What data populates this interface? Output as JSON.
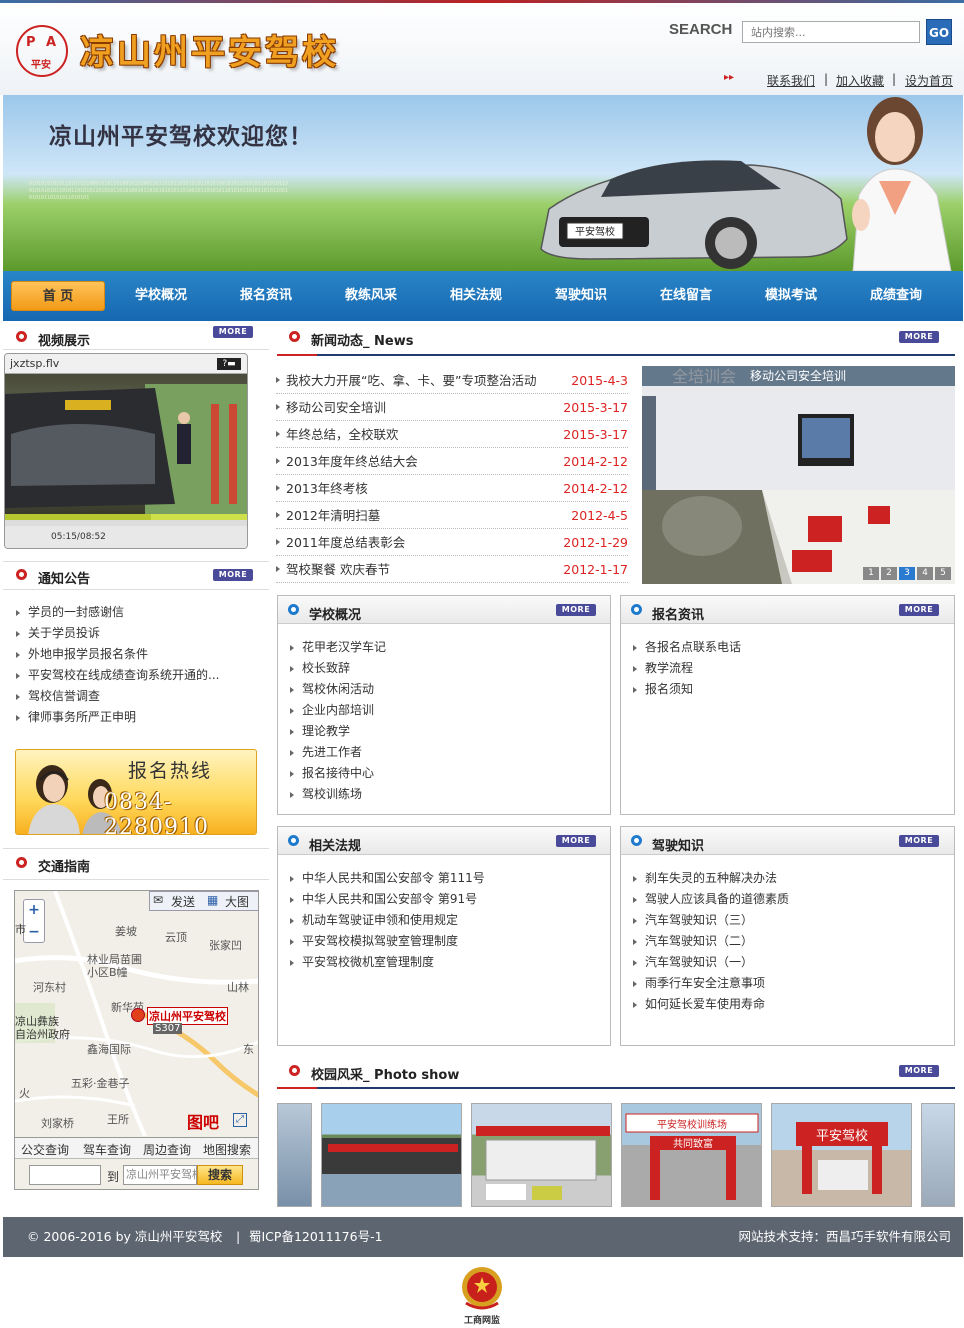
{
  "header": {
    "logo_letters": [
      "P",
      "A",
      "平安"
    ],
    "title": "凉山州平安驾校",
    "search_label": "SEARCH",
    "search_placeholder": "站内搜索...",
    "search_button": "GO",
    "links": [
      "联系我们",
      "加入收藏",
      "设为首页"
    ]
  },
  "banner": {
    "welcome": "凉山州平安驾校欢迎您！",
    "plate": "平安驾校"
  },
  "nav": [
    "首 页",
    "学校概况",
    "报名资讯",
    "教练风采",
    "相关法规",
    "驾驶知识",
    "在线留言",
    "模拟考试",
    "成绩查询"
  ],
  "more_label": "MORE",
  "video": {
    "title": "视频展示",
    "filename": "jxztsp.flv",
    "time": "05:15/08:52"
  },
  "notice": {
    "title": "通知公告",
    "items": [
      "学员的一封感谢信",
      "关于学员投诉",
      "外地申报学员报名条件",
      "平安驾校在线成绩查询系统开通的...",
      "驾校信誉调查",
      "律师事务所严正申明"
    ]
  },
  "hotline": {
    "label": "报名热线",
    "number": "0834-2280910"
  },
  "traffic": {
    "title": "交通指南",
    "map_buttons": [
      "发送",
      "大图"
    ],
    "map_labels": [
      "姜坡",
      "云顶",
      "张家凹",
      "林业局苗圃",
      "小区B幢",
      "河东村",
      "山林",
      "新华苑",
      "凉山州平安驾校",
      "S307",
      "凉山彝族",
      "自治州政府",
      "鑫海国际",
      "东",
      "五彩·金巷子",
      "火",
      "刘家桥",
      "王所",
      "图吧",
      "市"
    ],
    "map_tabs": [
      "公交查询",
      "驾车查询",
      "周边查询",
      "地图搜索"
    ],
    "route_to": "到",
    "route_dest": "凉山州平安驾校",
    "route_button": "搜索"
  },
  "news": {
    "title": "新闻动态_",
    "title_en": "News",
    "items": [
      {
        "title": "我校大力开展“吃、拿、卡、要”专项整治活动",
        "date": "2015-4-3"
      },
      {
        "title": "移动公司安全培训",
        "date": "2015-3-17"
      },
      {
        "title": "年终总结，全校联欢",
        "date": "2015-3-17"
      },
      {
        "title": "2013年度年终总结大会",
        "date": "2014-2-12"
      },
      {
        "title": "2013年终考核",
        "date": "2014-2-12"
      },
      {
        "title": "2012年清明扫墓",
        "date": "2012-4-5"
      },
      {
        "title": "2011年度总结表彰会",
        "date": "2012-1-29"
      },
      {
        "title": "驾校聚餐 欢庆春节",
        "date": "2012-1-17"
      }
    ],
    "slide_caption": "移动公司安全培训",
    "slide_bg_text": "全培训会",
    "slide_pages": [
      "1",
      "2",
      "3",
      "4",
      "5"
    ]
  },
  "school": {
    "title": "学校概况",
    "items": [
      "花甲老汉学车记",
      "校长致辞",
      "驾校休闲活动",
      "企业内部培训",
      "理论教学",
      "先进工作者",
      "报名接待中心",
      "驾校训练场"
    ]
  },
  "signup": {
    "title": "报名资讯",
    "items": [
      "各报名点联系电话",
      "教学流程",
      "报名须知"
    ]
  },
  "laws": {
    "title": "相关法规",
    "items": [
      "中华人民共和国公安部令 第111号",
      "中华人民共和国公安部令 第91号",
      "机动车驾驶证申领和使用规定",
      "平安驾校模拟驾驶室管理制度",
      "平安驾校微机室管理制度"
    ]
  },
  "knowledge": {
    "title": "驾驶知识",
    "items": [
      "刹车失灵的五种解决办法",
      "驾驶人应该具备的道德素质",
      "汽车驾驶知识（三）",
      "汽车驾驶知识（二）",
      "汽车驾驶知识（一）",
      "雨季行车安全注意事项",
      "如何延长爱车使用寿命"
    ]
  },
  "photos": {
    "title": "校园风采_",
    "title_en": "Photo show",
    "signs": [
      "平安驾校训练场",
      "共同致富",
      "平安驾校"
    ]
  },
  "footer": {
    "copyright": "© 2006-2016 by 凉山州平安驾校",
    "icp": "蜀ICP备12011176号-1",
    "support": "网站技术支持：西昌巧手软件有限公司"
  },
  "badge": {
    "label": "工商网监"
  }
}
